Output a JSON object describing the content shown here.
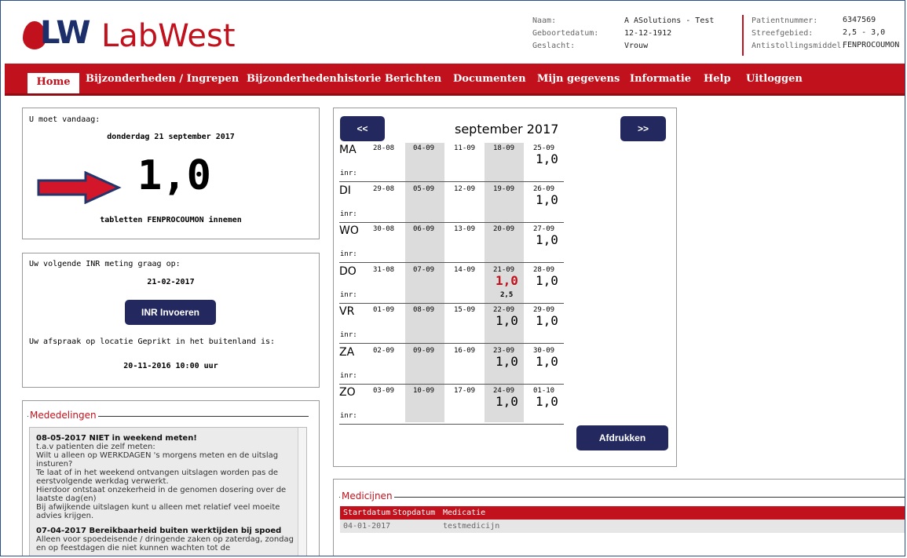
{
  "app": {
    "logo_letters": "LW",
    "name": "LabWest"
  },
  "patient": {
    "naam_label": "Naam:",
    "naam": "A ASolutions - Test",
    "geboortedatum_label": "Geboortedatum:",
    "geboortedatum": "12-12-1912",
    "geslacht_label": "Geslacht:",
    "geslacht": "Vrouw",
    "patientnummer_label": "Patientnummer:",
    "patientnummer": "6347569",
    "streefgebied_label": "Streefgebied:",
    "streefgebied": "2,5 - 3,0",
    "antistollingsmiddel_label": "Antistollingsmiddel:",
    "antistollingsmiddel": "FENPROCOUMON"
  },
  "nav": {
    "home": "Home",
    "items": [
      "Bijzonderheden / Ingrepen",
      "Bijzonderhedenhistorie",
      "Berichten",
      "Documenten",
      "Mijn gegevens",
      "Informatie",
      "Help",
      "Uitloggen"
    ]
  },
  "today": {
    "heading": "U moet vandaag:",
    "date": "donderdag 21 september 2017",
    "dose": "1,0",
    "instruction": "tabletten FENPROCOUMON innemen"
  },
  "next": {
    "heading": "Uw volgende INR meting graag op:",
    "date": "21-02-2017",
    "button": "INR Invoeren",
    "appt_heading": "Uw afspraak op locatie Geprikt in het buitenland is:",
    "appt": "20-11-2016 10:00 uur"
  },
  "calendar": {
    "prev": "<<",
    "next": ">>",
    "month": "september 2017",
    "inr_label": "inr:",
    "print": "Afdrukken",
    "rows": [
      {
        "day": "MA",
        "dates": [
          "28-08",
          "04-09",
          "11-09",
          "18-09",
          "25-09"
        ],
        "doses": [
          "",
          "",
          "",
          "",
          "1,0"
        ],
        "inr": ""
      },
      {
        "day": "DI",
        "dates": [
          "29-08",
          "05-09",
          "12-09",
          "19-09",
          "26-09"
        ],
        "doses": [
          "",
          "",
          "",
          "",
          "1,0"
        ],
        "inr": ""
      },
      {
        "day": "WO",
        "dates": [
          "30-08",
          "06-09",
          "13-09",
          "20-09",
          "27-09"
        ],
        "doses": [
          "",
          "",
          "",
          "",
          "1,0"
        ],
        "inr": ""
      },
      {
        "day": "DO",
        "dates": [
          "31-08",
          "07-09",
          "14-09",
          "21-09",
          "28-09"
        ],
        "doses": [
          "",
          "",
          "",
          "1,0",
          "1,0"
        ],
        "inr": "2,5"
      },
      {
        "day": "VR",
        "dates": [
          "01-09",
          "08-09",
          "15-09",
          "22-09",
          "29-09"
        ],
        "doses": [
          "",
          "",
          "",
          "1,0",
          "1,0"
        ],
        "inr": ""
      },
      {
        "day": "ZA",
        "dates": [
          "02-09",
          "09-09",
          "16-09",
          "23-09",
          "30-09"
        ],
        "doses": [
          "",
          "",
          "",
          "1,0",
          "1,0"
        ],
        "inr": ""
      },
      {
        "day": "ZO",
        "dates": [
          "03-09",
          "10-09",
          "17-09",
          "24-09",
          "01-10"
        ],
        "doses": [
          "",
          "",
          "",
          "1,0",
          "1,0"
        ],
        "inr": ""
      }
    ],
    "highlight_color": "#c0111c"
  },
  "mededelingen": {
    "title": "Mededelingen",
    "messages": [
      {
        "title": "08-05-2017 NIET in weekend meten!",
        "body": "t.a.v patienten die zelf meten:\nWilt u alleen op WERKDAGEN 's morgens meten en de uitslag insturen?\nTe laat of in het weekend ontvangen uitslagen worden pas de eerstvolgende werkdag verwerkt.\nHierdoor ontstaat onzekerheid in de genomen dosering over de laatste dag(en)\nBij afwijkende uitslagen kunt u alleen met  relatief veel moeite advies krijgen."
      },
      {
        "title": "07-04-2017 Bereikbaarheid buiten werktijden bij spoed",
        "body": "Alleen voor spoedeisende / dringende zaken op zaterdag, zondag en op feestdagen die niet kunnen wachten tot de"
      }
    ]
  },
  "medicijnen": {
    "title": "Medicijnen",
    "columns": [
      "Startdatum",
      "Stopdatum",
      "Medicatie"
    ],
    "rows": [
      [
        "04-01-2017",
        "",
        "testmedicijn"
      ]
    ]
  },
  "colors": {
    "brand_red": "#c0111c",
    "brand_navy": "#23295f"
  }
}
